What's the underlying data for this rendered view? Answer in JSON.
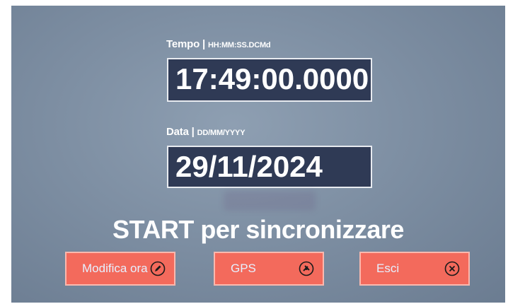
{
  "time_field": {
    "label": "Tempo | ",
    "format": "HH:MM:SS.DCMd",
    "value": "17:49:00.0000"
  },
  "date_field": {
    "label": "Data | ",
    "format": "DD/MM/YYYY",
    "value": "29/11/2024"
  },
  "sync_message": "START per sincronizzare",
  "buttons": {
    "edit_time": {
      "label": "Modifica ora",
      "icon": "pencil-icon"
    },
    "gps": {
      "label": "GPS",
      "icon": "satellite-icon"
    },
    "exit": {
      "label": "Esci",
      "icon": "close-circle-icon"
    }
  },
  "colors": {
    "background": "#7e8fa3",
    "field_box": "#2f3a55",
    "button": "#f36a5c",
    "button_border": "#fbb8ae",
    "text": "#ffffff"
  }
}
